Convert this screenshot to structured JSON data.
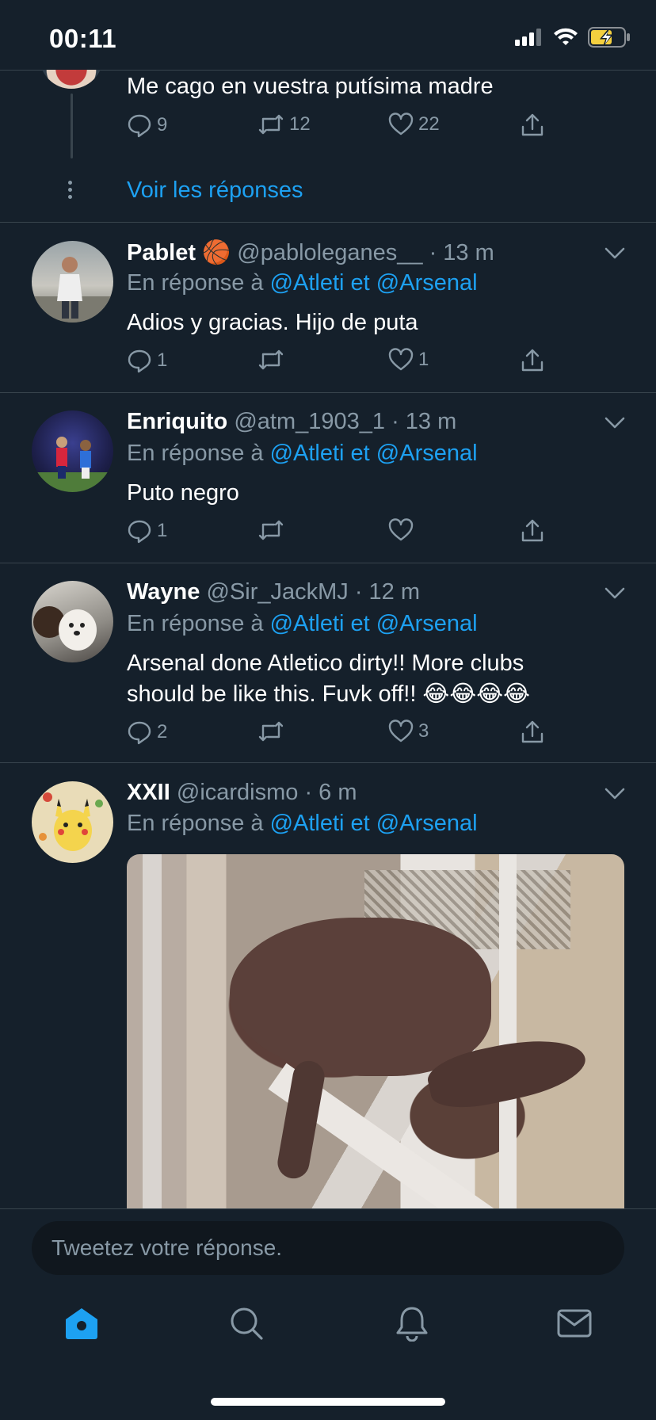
{
  "status_bar": {
    "time": "00:11"
  },
  "top_tweet": {
    "text": "Me cago en vuestra putísima madre",
    "replies": "9",
    "retweets": "12",
    "likes": "22",
    "show_replies_label": "Voir les réponses"
  },
  "tweets": [
    {
      "name": "Pablet",
      "emoji": "🏀",
      "handle": "@pabloleganes__",
      "time": "· 13 m",
      "reply_prefix": "En réponse à",
      "reply_targets": "@Atleti et @Arsenal",
      "text": "Adios y gracias. Hijo de puta",
      "replies": "1",
      "retweets": "",
      "likes": "1"
    },
    {
      "name": "Enriquito",
      "handle": "@atm_1903_1",
      "time": "· 13 m",
      "reply_prefix": "En réponse à",
      "reply_targets": "@Atleti et @Arsenal",
      "text": "Puto negro",
      "replies": "1",
      "retweets": "",
      "likes": ""
    },
    {
      "name": "Wayne",
      "handle": "@Sir_JackMJ",
      "time": "· 12 m",
      "reply_prefix": "En réponse à",
      "reply_targets": "@Atleti et @Arsenal",
      "text_line1": "Arsenal done Atletico dirty!! More clubs",
      "text_line2": "should be like this. Fuvk off!! 😂😂😂😂",
      "replies": "2",
      "retweets": "",
      "likes": "3"
    },
    {
      "name": "XXII",
      "handle": "@icardismo",
      "time": "· 6 m",
      "reply_prefix": "En réponse à",
      "reply_targets": "@Atleti et @Arsenal"
    }
  ],
  "reply_box": {
    "placeholder": "Tweetez votre réponse."
  },
  "tabbar": {
    "items": [
      "home-icon",
      "search-icon",
      "bell-icon",
      "mail-icon"
    ],
    "accent": "#1da1f2",
    "inactive": "#8899a6"
  },
  "colors": {
    "background": "#15202b",
    "link": "#1da1f2",
    "muted": "#8899a6",
    "divider": "#38444d"
  }
}
